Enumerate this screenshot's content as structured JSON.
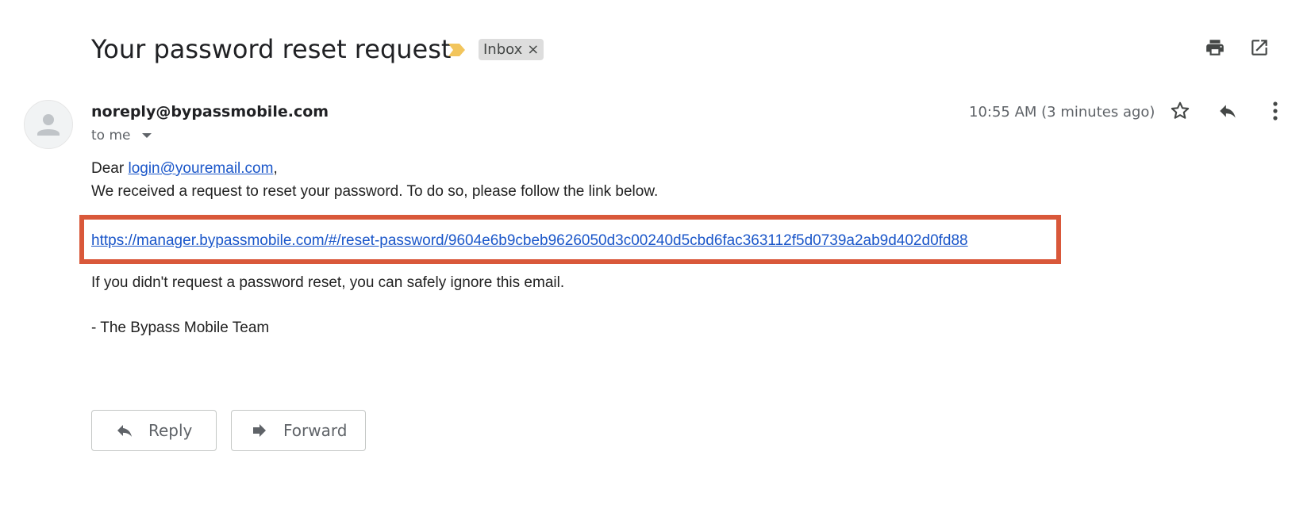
{
  "email": {
    "subject": "Your password reset request",
    "label": "Inbox",
    "label_close": "×",
    "sender": "noreply@bypassmobile.com",
    "recipient_summary": "to me",
    "timestamp": "10:55 AM (3 minutes ago)",
    "body": {
      "greeting_prefix": "Dear ",
      "greeting_email": "login@youremail.com",
      "greeting_suffix": ",",
      "line1": "We received a request to reset your password. To do so, please follow the link below.",
      "reset_link": "https://manager.bypassmobile.com/#/reset-password/9604e6b9cbeb9626050d3c00240d5cbd6fac363112f5d0739a2ab9d402d0fd88",
      "line2": "If you didn't request a password reset, you can safely ignore this email.",
      "signature": "- The Bypass Mobile Team"
    }
  },
  "actions": {
    "reply_label": "Reply",
    "forward_label": "Forward"
  },
  "icons": {
    "importance": "importance-marker-icon",
    "print": "print-icon",
    "open_new_window": "open-in-new-window-icon",
    "star": "star-icon",
    "reply": "reply-icon",
    "more": "more-vert-icon",
    "avatar": "default-avatar-icon",
    "forward": "forward-icon"
  },
  "colors": {
    "highlight_border": "#d9583a",
    "link": "#1a56c9",
    "importance": "#f2c55c",
    "label_bg": "#dddddd"
  }
}
